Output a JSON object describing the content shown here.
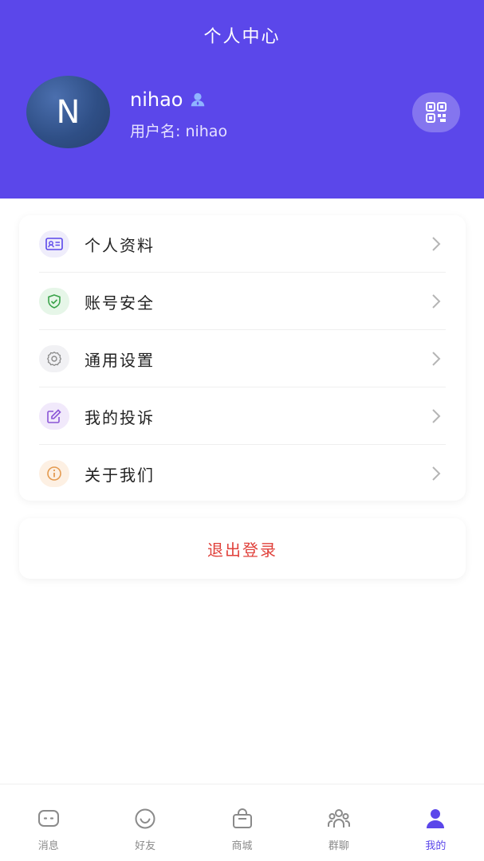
{
  "header": {
    "title": "个人中心",
    "avatar_letter": "N",
    "user_name": "nihao",
    "username_line": "用户名: nihao",
    "icons": {
      "badge": "user-badge-icon",
      "qr": "qr-code-icon"
    },
    "colors": {
      "background": "#5b47ea"
    }
  },
  "menu": {
    "items": [
      {
        "label": "个人资料",
        "icon": "profile-card-icon",
        "color": "#5b47ea",
        "bg": "#efedfb"
      },
      {
        "label": "账号安全",
        "icon": "shield-check-icon",
        "color": "#3aa34a",
        "bg": "#e6f6e8"
      },
      {
        "label": "通用设置",
        "icon": "gear-icon",
        "color": "#8a8a8a",
        "bg": "#f1f1f4"
      },
      {
        "label": "我的投诉",
        "icon": "edit-icon",
        "color": "#8a55d6",
        "bg": "#f1e9fb"
      },
      {
        "label": "关于我们",
        "icon": "info-icon",
        "color": "#e49a4f",
        "bg": "#fdf0e3"
      }
    ]
  },
  "logout": {
    "label": "退出登录",
    "color": "#e0413b"
  },
  "tabbar": {
    "tabs": [
      {
        "label": "消息",
        "icon": "chat-icon",
        "active": false
      },
      {
        "label": "好友",
        "icon": "smile-icon",
        "active": false
      },
      {
        "label": "商城",
        "icon": "shopping-bag-icon",
        "active": false
      },
      {
        "label": "群聊",
        "icon": "group-icon",
        "active": false
      },
      {
        "label": "我的",
        "icon": "person-icon",
        "active": true
      }
    ],
    "colors": {
      "active": "#5b47ea",
      "inactive": "#8a8a8a"
    }
  }
}
